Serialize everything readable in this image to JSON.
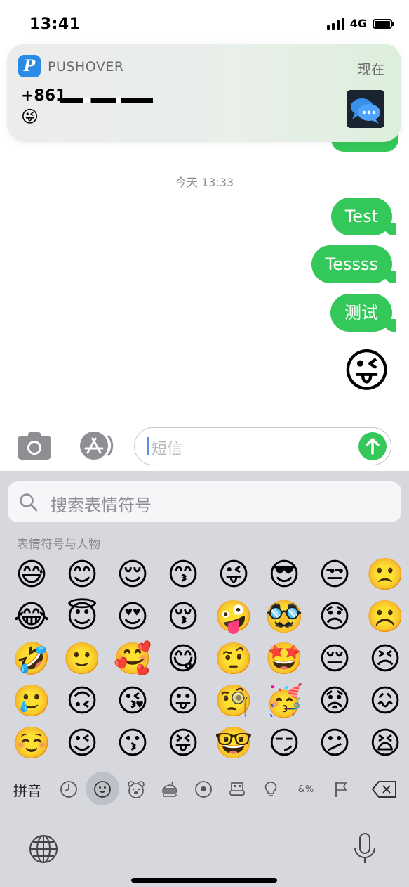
{
  "status_bar": {
    "time": "13:41",
    "network": "4G"
  },
  "notification": {
    "app_name": "PUSHOVER",
    "time": "现在",
    "title": "+861",
    "body": "😜",
    "app_icon_letter": "P"
  },
  "conversation": {
    "date_label": "今天 13:33",
    "messages": [
      {
        "text": "Test"
      },
      {
        "text": "Tessss"
      },
      {
        "text": "测试"
      },
      {
        "text": "😜"
      }
    ]
  },
  "input_bar": {
    "placeholder": "短信"
  },
  "keyboard": {
    "search_placeholder": "搜索表情符号",
    "category_label": "表情符号与人物",
    "emoji_rows": [
      [
        "😅",
        "😊",
        "😌",
        "😙",
        "😜",
        "😎",
        "😒",
        "🙁"
      ],
      [
        "😂",
        "😇",
        "😍",
        "😚",
        "🤪",
        "🥸",
        "😞",
        "☹️"
      ],
      [
        "🤣",
        "🙂",
        "🥰",
        "😋",
        "🤨",
        "🤩",
        "😔",
        "😣"
      ],
      [
        "🥲",
        "🙃",
        "😘",
        "😛",
        "🧐",
        "🥳",
        "😟",
        "😖"
      ],
      [
        "☺️",
        "😉",
        "😗",
        "😝",
        "🤓",
        "😏",
        "😕",
        "😫"
      ]
    ],
    "tabs": {
      "pinyin": "拼音",
      "recent": "🕘",
      "smileys": "☺",
      "animals": "🐻",
      "food": "🍔",
      "activity": "⚽",
      "travel": "🏢",
      "objects": "💡",
      "symbols": "&%",
      "flags": "⚑",
      "delete": "⌫"
    }
  },
  "colors": {
    "bubble": "#34c759",
    "keyboard_bg": "#d6d8de",
    "notification_icon": "#2a8be6"
  }
}
